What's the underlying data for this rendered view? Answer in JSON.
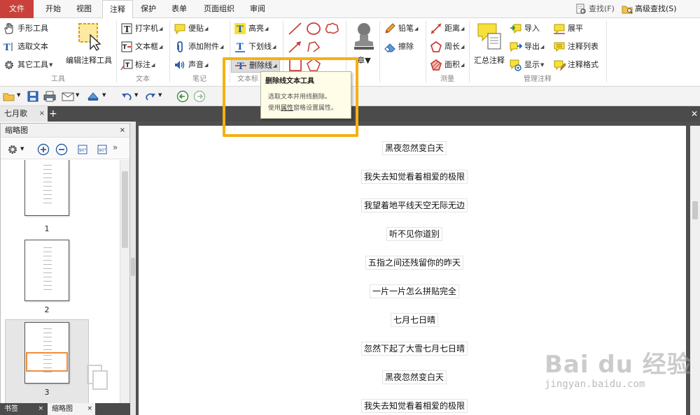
{
  "menu": {
    "tabs": [
      "文件",
      "开始",
      "视图",
      "注释",
      "保护",
      "表单",
      "页面组织",
      "审阅"
    ],
    "active_index": 3,
    "search_label": "查找(F)",
    "adv_search_label": "高级查找(S)"
  },
  "ribbon": {
    "tools": {
      "hand": "手形工具",
      "select_text": "选取文本",
      "other": "其它工具",
      "edit_annotation": "编辑注释工具",
      "label": "工具"
    },
    "text": {
      "typewriter": "打字机",
      "textbox": "文本框",
      "callout": "标注",
      "label": "文本"
    },
    "notes": {
      "sticky": "便贴",
      "attach": "添加附件",
      "sound": "声音",
      "label": "笔记"
    },
    "markup": {
      "highlight": "高亮",
      "underline": "下划线",
      "strikeout": "删除线",
      "label": "文本标"
    },
    "stamp": {
      "label_partial": "章"
    },
    "drawing": {
      "pencil": "铅笔",
      "eraser": "擦除"
    },
    "measure": {
      "distance": "距离",
      "perimeter": "周长",
      "area": "面积",
      "label": "测量"
    },
    "manage": {
      "summary": "汇总注释",
      "import": "导入",
      "export": "导出",
      "show": "显示",
      "flatten": "展平",
      "list": "注释列表",
      "format": "注释格式",
      "label": "管理注释"
    }
  },
  "tooltip": {
    "title": "删除线文本工具",
    "line1": "选取文本并用线删除。",
    "line2_pre": "使用",
    "line2_link": "属性",
    "line2_post": "窗格设置属性。"
  },
  "doc_tab": {
    "name": "七月歌",
    "close": "×",
    "add": "+"
  },
  "left_panel": {
    "title": "缩略图",
    "close": "×",
    "thumbnails": [
      {
        "number": "1"
      },
      {
        "number": "2"
      },
      {
        "number": "3"
      }
    ],
    "bottom_tabs": [
      "书签",
      "缩略图"
    ]
  },
  "document": {
    "lines": [
      "黑夜忽然变白天",
      "我失去知觉看着相爱的极限",
      "我望着地平线天空无际无边",
      "听不见你道别",
      "五指之间还残留你的昨天",
      "一片一片怎么拼贴完全",
      "七月七日晴",
      "忽然下起了大雪七月七日晴",
      "黑夜忽然变白天",
      "我失去知觉看着相爱的极限"
    ]
  },
  "watermark": {
    "brand": "Bai du 经验",
    "url": "jingyan.baidu.com"
  },
  "colors": {
    "file_tab": "#c9413a",
    "highlight_box": "#f5b012",
    "thumb_highlight": "#f08c3a"
  }
}
